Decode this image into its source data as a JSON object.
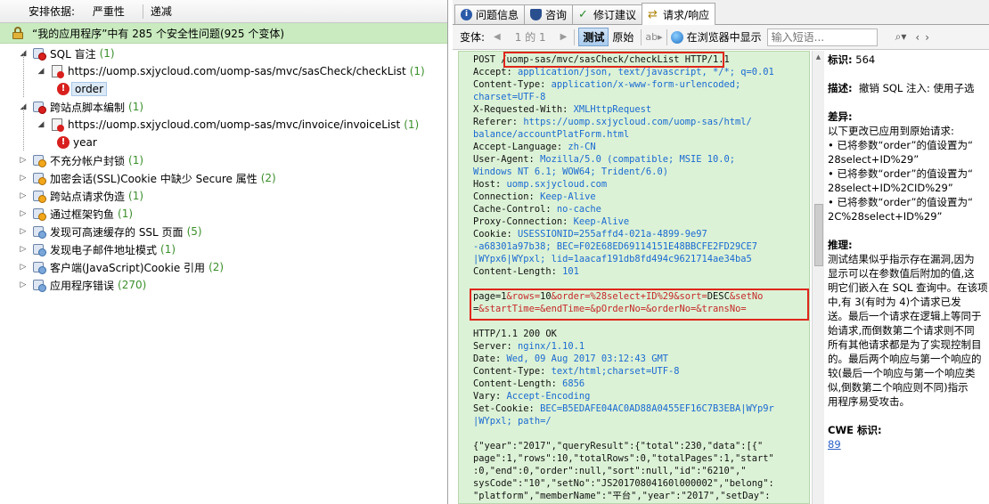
{
  "left": {
    "sort_label": "安排依据:",
    "sort_value": "严重性",
    "sort_order": "递减",
    "summary": "“我的应用程序”中有 285 个安全性问题(925 个变体)",
    "tree": [
      {
        "label": "SQL 盲注",
        "count": "(1)",
        "severity": "high",
        "expanded": true
      },
      {
        "label": "https://uomp.sxjycloud.com/uomp-sas/mvc/sasCheck/checkList",
        "count": "(1)",
        "kind": "url"
      },
      {
        "label": "order",
        "count": "",
        "kind": "param",
        "selected": true
      },
      {
        "label": "跨站点脚本编制",
        "count": "(1)",
        "severity": "high",
        "expanded": true
      },
      {
        "label": "https://uomp.sxjycloud.com/uomp-sas/mvc/invoice/invoiceList",
        "count": "(1)",
        "kind": "url"
      },
      {
        "label": "year",
        "count": "",
        "kind": "param"
      },
      {
        "label": "不充分帐户封锁",
        "count": "(1)",
        "severity": "med"
      },
      {
        "label": "加密会话(SSL)Cookie 中缺少 Secure 属性",
        "count": "(2)",
        "severity": "med"
      },
      {
        "label": "跨站点请求伪造",
        "count": "(1)",
        "severity": "med"
      },
      {
        "label": "通过框架钓鱼",
        "count": "(1)",
        "severity": "med"
      },
      {
        "label": "发现可高速缓存的 SSL 页面",
        "count": "(5)",
        "severity": "low"
      },
      {
        "label": "发现电子邮件地址模式",
        "count": "(1)",
        "severity": "low"
      },
      {
        "label": "客户端(JavaScript)Cookie 引用",
        "count": "(2)",
        "severity": "low"
      },
      {
        "label": "应用程序错误",
        "count": "(270)",
        "severity": "low"
      }
    ]
  },
  "right": {
    "tabs": [
      "问题信息",
      "咨询",
      "修订建议",
      "请求/响应"
    ],
    "toolbar": {
      "variant_label": "变体:",
      "page": "1 的 1",
      "test_btn": "测试",
      "original_btn": "原始",
      "ab": "ab",
      "browser_btn": "在浏览器中显示",
      "search_placeholder": "输入短语..."
    },
    "request_lines": [
      [
        {
          "t": "POST ",
          "c": "k"
        },
        {
          "t": "/uomp-sas/mvc/sasCheck/checkList",
          "c": "k"
        },
        {
          "t": " HTTP/1.1",
          "c": "k"
        }
      ],
      [
        {
          "t": "Accept: ",
          "c": "k"
        },
        {
          "t": "application/json, text/javascript, */*; q=0.01",
          "c": "v"
        }
      ],
      [
        {
          "t": "Content-Type: ",
          "c": "k"
        },
        {
          "t": "application/x-www-form-urlencoded;",
          "c": "v"
        }
      ],
      [
        {
          "t": "charset=UTF-8",
          "c": "v"
        }
      ],
      [
        {
          "t": "X-Requested-With: ",
          "c": "k"
        },
        {
          "t": "XMLHttpRequest",
          "c": "v"
        }
      ],
      [
        {
          "t": "Referer: ",
          "c": "k"
        },
        {
          "t": "https://uomp.sxjycloud.com/uomp-sas/html/",
          "c": "v"
        }
      ],
      [
        {
          "t": "balance/accountPlatForm.html",
          "c": "v"
        }
      ],
      [
        {
          "t": "Accept-Language: ",
          "c": "k"
        },
        {
          "t": "zh-CN",
          "c": "v"
        }
      ],
      [
        {
          "t": "User-Agent: ",
          "c": "k"
        },
        {
          "t": "Mozilla/5.0 (compatible; MSIE 10.0;",
          "c": "v"
        }
      ],
      [
        {
          "t": "Windows NT 6.1; WOW64; Trident/6.0)",
          "c": "v"
        }
      ],
      [
        {
          "t": "Host: ",
          "c": "k"
        },
        {
          "t": "uomp.sxjycloud.com",
          "c": "v"
        }
      ],
      [
        {
          "t": "Connection: ",
          "c": "k"
        },
        {
          "t": "Keep-Alive",
          "c": "v"
        }
      ],
      [
        {
          "t": "Cache-Control: ",
          "c": "k"
        },
        {
          "t": "no-cache",
          "c": "v"
        }
      ],
      [
        {
          "t": "Proxy-Connection: ",
          "c": "k"
        },
        {
          "t": "Keep-Alive",
          "c": "v"
        }
      ],
      [
        {
          "t": "Cookie: ",
          "c": "k"
        },
        {
          "t": "USESSIONID=255affd4-021a-4899-9e97",
          "c": "v"
        }
      ],
      [
        {
          "t": "-a68301a97b38; BEC=F02E68ED69114151E48BBCFE2FD29CE7",
          "c": "v"
        }
      ],
      [
        {
          "t": "|WYpx6|WYpxl; lid=1aacaf191db8fd494c9621714ae34ba5",
          "c": "v"
        }
      ],
      [
        {
          "t": "Content-Length: ",
          "c": "k"
        },
        {
          "t": "101",
          "c": "v"
        }
      ],
      [
        {
          "t": "",
          "c": "k"
        }
      ],
      [
        {
          "t": "page=1",
          "c": "k"
        },
        {
          "t": "&rows=",
          "c": "r"
        },
        {
          "t": "10",
          "c": "k"
        },
        {
          "t": "&order=%28select+ID%29",
          "c": "r"
        },
        {
          "t": "&sort=",
          "c": "r"
        },
        {
          "t": "DESC",
          "c": "k"
        },
        {
          "t": "&setNo",
          "c": "r"
        }
      ],
      [
        {
          "t": "=",
          "c": "k"
        },
        {
          "t": "&startTime=",
          "c": "r"
        },
        {
          "t": "&endTime=",
          "c": "r"
        },
        {
          "t": "&pOrderNo=",
          "c": "r"
        },
        {
          "t": "&orderNo=",
          "c": "r"
        },
        {
          "t": "&transNo=",
          "c": "r"
        }
      ],
      [
        {
          "t": "",
          "c": "k"
        }
      ],
      [
        {
          "t": "HTTP/1.1 200 OK",
          "c": "k"
        }
      ],
      [
        {
          "t": "Server: ",
          "c": "k"
        },
        {
          "t": "nginx/1.10.1",
          "c": "v"
        }
      ],
      [
        {
          "t": "Date: ",
          "c": "k"
        },
        {
          "t": "Wed, 09 Aug 2017 03:12:43 GMT",
          "c": "v"
        }
      ],
      [
        {
          "t": "Content-Type: ",
          "c": "k"
        },
        {
          "t": "text/html;charset=UTF-8",
          "c": "v"
        }
      ],
      [
        {
          "t": "Content-Length: ",
          "c": "k"
        },
        {
          "t": "6856",
          "c": "v"
        }
      ],
      [
        {
          "t": "Vary: ",
          "c": "k"
        },
        {
          "t": "Accept-Encoding",
          "c": "v"
        }
      ],
      [
        {
          "t": "Set-Cookie: ",
          "c": "k"
        },
        {
          "t": "BEC=B5EDAFE04AC0AD88A0455EF16C7B3EBA|WYp9r",
          "c": "v"
        }
      ],
      [
        {
          "t": "|WYpxl; path=/",
          "c": "v"
        }
      ],
      [
        {
          "t": "",
          "c": "k"
        }
      ],
      [
        {
          "t": "{\"year\":\"2017\",\"queryResult\":{\"total\":230,\"data\":[{\"",
          "c": "k"
        }
      ],
      [
        {
          "t": "page\":1,\"rows\":10,\"totalRows\":0,\"totalPages\":1,\"start\"",
          "c": "k"
        }
      ],
      [
        {
          "t": ":0,\"end\":0,\"order\":null,\"sort\":null,\"id\":\"6210\",\"",
          "c": "k"
        }
      ],
      [
        {
          "t": "sysCode\":\"10\",\"setNo\":\"JS20170804160l000002\",\"belong\":",
          "c": "k"
        }
      ],
      [
        {
          "t": "\"platform\",\"memberName\":\"平台\",\"year\":\"2017\",\"setDay\":",
          "c": "k"
        }
      ]
    ],
    "details": {
      "id_label": "标识:",
      "id_value": "564",
      "desc_label": "描述:",
      "desc_value": "撤销 SQL 注入: 使用子选",
      "diff_label": "差异:",
      "diff_intro": "以下更改已应用到原始请求:",
      "diff_items": [
        "• 已将参数“order”的值设置为“",
        "28select+ID%29”",
        "• 已将参数“order”的值设置为“",
        "28select+ID%2CID%29”",
        "• 已将参数“order”的值设置为“",
        "2C%28select+ID%29”"
      ],
      "reason_label": "推理:",
      "reason_lines": [
        "测试结果似乎指示存在漏洞,因为",
        "显示可以在参数值后附加的值,这",
        "明它们嵌入在 SQL 查询中。在该项",
        "中,有 3(有时为 4)个请求已发",
        "送。最后一个请求在逻辑上等同于",
        "始请求,而倒数第二个请求则不同",
        "所有其他请求都是为了实现控制目",
        "的。最后两个响应与第一个响应的",
        "较(最后一个响应与第一个响应类",
        "似,倒数第二个响应则不同)指示",
        "用程序易受攻击。"
      ],
      "cwe_label": "CWE 标识:",
      "cwe_value": "89"
    }
  }
}
